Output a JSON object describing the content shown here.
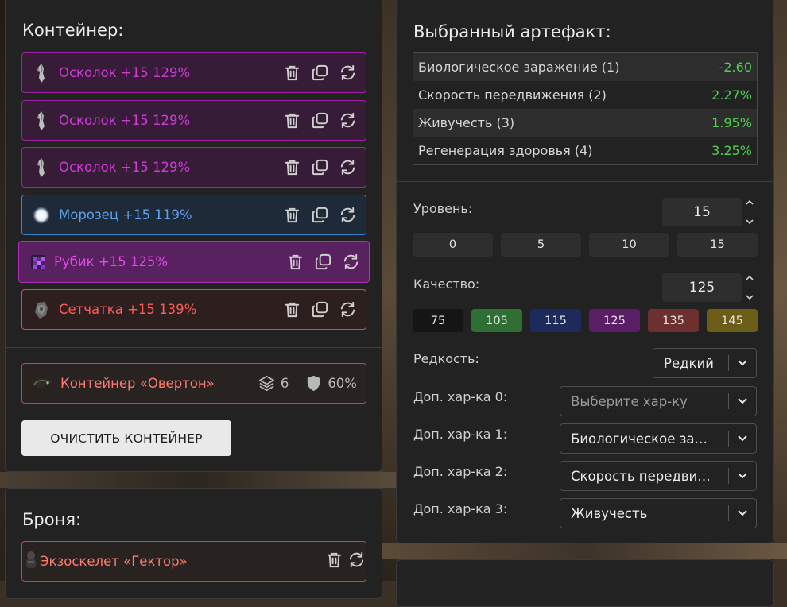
{
  "container": {
    "title": "Контейнер:",
    "items": [
      {
        "label": "Осколок +15 129%",
        "color": "purple"
      },
      {
        "label": "Осколок +15 129%",
        "color": "purple"
      },
      {
        "label": "Осколок +15 129%",
        "color": "purple"
      },
      {
        "label": "Морозец +15 119%",
        "color": "blue"
      },
      {
        "label": "Рубик +15 125%",
        "color": "purple",
        "selected": true
      },
      {
        "label": "Сетчатка +15 139%",
        "color": "red"
      }
    ],
    "container_name": "Контейнер «Овертон»",
    "slots": "6",
    "protection": "60%",
    "clear_label": "ОЧИСТИТЬ КОНТЕЙНЕР"
  },
  "armor": {
    "title": "Броня:",
    "name": "Экзоскелет «Гектор»"
  },
  "artifact": {
    "title": "Выбранный артефакт:",
    "stats": [
      {
        "name": "Биологическое заражение (1)",
        "value": "-2.60"
      },
      {
        "name": "Скорость передвижения (2)",
        "value": "2.27%"
      },
      {
        "name": "Живучесть (3)",
        "value": "1.95%"
      },
      {
        "name": "Регенерация здоровья (4)",
        "value": "3.25%"
      }
    ],
    "level_label": "Уровень:",
    "level_value": "15",
    "level_presets": [
      "0",
      "5",
      "10",
      "15"
    ],
    "quality_label": "Качество:",
    "quality_value": "125",
    "quality_presets": [
      {
        "label": "75",
        "color": "#151515"
      },
      {
        "label": "105",
        "color": "#2f6f34"
      },
      {
        "label": "115",
        "color": "#1d2a5c"
      },
      {
        "label": "125",
        "color": "#5a1d66"
      },
      {
        "label": "135",
        "color": "#6e2f2f"
      },
      {
        "label": "145",
        "color": "#6b5d17"
      }
    ],
    "rarity_label": "Редкость:",
    "rarity_value": "Редкий",
    "extra": [
      {
        "label": "Доп. хар-ка 0:",
        "value": "Выберите хар-ку",
        "placeholder": true
      },
      {
        "label": "Доп. хар-ка 1:",
        "value": "Биологическое за…"
      },
      {
        "label": "Доп. хар-ка 2:",
        "value": "Скорость передви…"
      },
      {
        "label": "Доп. хар-ка 3:",
        "value": "Живучесть"
      }
    ]
  },
  "icons": {
    "delete": "trash-icon",
    "copy": "copy-icon",
    "swap": "swap-icon",
    "layers": "layers-icon",
    "shield": "shield-icon"
  }
}
